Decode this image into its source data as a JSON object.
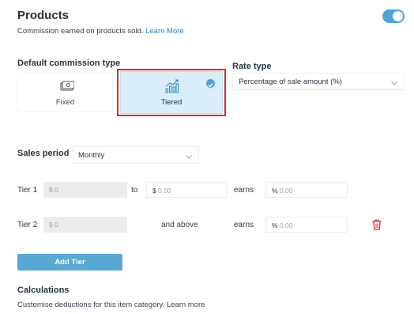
{
  "header": {
    "title": "Products",
    "subtitle": "Commission earned on products sold.",
    "learn_more": "Learn More",
    "toggle_on": true
  },
  "commission": {
    "label": "Default commission type",
    "options": [
      {
        "label": "Fixed",
        "icon": "cash-icon",
        "selected": false
      },
      {
        "label": "Tiered",
        "icon": "bar-chart-trend-icon",
        "selected": true
      }
    ]
  },
  "rate": {
    "label": "Rate type",
    "value": "Percentage of sale amount (%)"
  },
  "sales_period": {
    "label": "Sales period",
    "value": "Monthly"
  },
  "tiers": {
    "tier1": {
      "label": "Tier 1",
      "from_placeholder": "$ 0",
      "to_label": "to",
      "to_currency": "$",
      "to_placeholder": "0.00",
      "earns_label": "earns",
      "pct_symbol": "%",
      "pct_placeholder": "0.00"
    },
    "tier2": {
      "label": "Tier 2",
      "from_placeholder": "$ 0",
      "above_label": "and above",
      "earns_label": "earns",
      "pct_symbol": "%",
      "pct_placeholder": "0.00",
      "delete_icon": "trash-icon"
    }
  },
  "add_tier_label": "Add Tier",
  "calculations": {
    "title": "Calculations",
    "subtitle": "Customise deductions for this item category.",
    "learn_more": "Learn more"
  },
  "colors": {
    "accent": "#4fa3d1",
    "selected_bg": "#d9eef8",
    "highlight": "#d82b2b",
    "delete": "#d82b2b"
  }
}
